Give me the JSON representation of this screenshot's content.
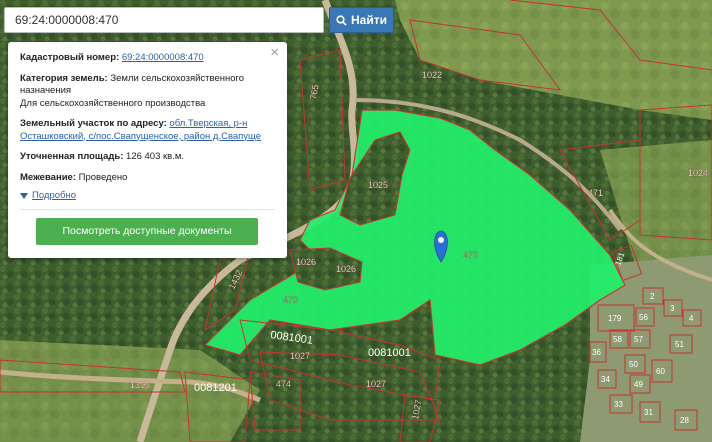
{
  "search": {
    "value": "69:24:0000008:470",
    "button_label": "Найти",
    "button_icon": "search-icon"
  },
  "popup": {
    "close_glyph": "×",
    "cadastral_label": "Кадастровый номер:",
    "cadastral_value": "69:24:0000008:470",
    "category_label": "Категория земель:",
    "category_line1": "Земли сельскохозяйственного",
    "category_line2": "назначения",
    "category_line3": "Для сельскохозяйственного производства",
    "address_label": "Земельный участок по адресу:",
    "address_link1": "обл.Тверская, р-н",
    "address_link2": "Осташковский, с/пос.Свапущенское, район д.Свапуще",
    "area_label": "Уточненная площадь:",
    "area_value": "126 403 кв.м.",
    "survey_label": "Межевание:",
    "survey_value": "Проведено",
    "more_label": "Подробно",
    "docs_button": "Посмотреть доступные документы"
  },
  "map": {
    "selected_parcel_color": "#22f06a",
    "boundary_color": "#c83232",
    "marker_color": "#2b6fd6",
    "labels": {
      "p470_main": "470",
      "p470_left": "470",
      "p1025": "1025",
      "p1026a": "1026",
      "p1026b": "1026",
      "p1022": "1022",
      "p1024": "1024",
      "p471": "471",
      "p765": "765",
      "p1432": "1432",
      "p1395": "1395",
      "p474": "474",
      "p1027a": "1027",
      "p1027b": "1027",
      "q1001a": "0081001",
      "q1001b": "0081001",
      "q1201": "0081201",
      "p1027c": "1027",
      "p181": "181",
      "p179": "179",
      "p2": "2",
      "p3": "3",
      "p4": "4",
      "p56": "56",
      "p57": "57",
      "p58": "58",
      "p51": "51",
      "p36": "36",
      "p50": "50",
      "p49": "49",
      "p34": "34",
      "p33": "33",
      "p60": "60",
      "p31": "31",
      "p28": "28"
    }
  }
}
